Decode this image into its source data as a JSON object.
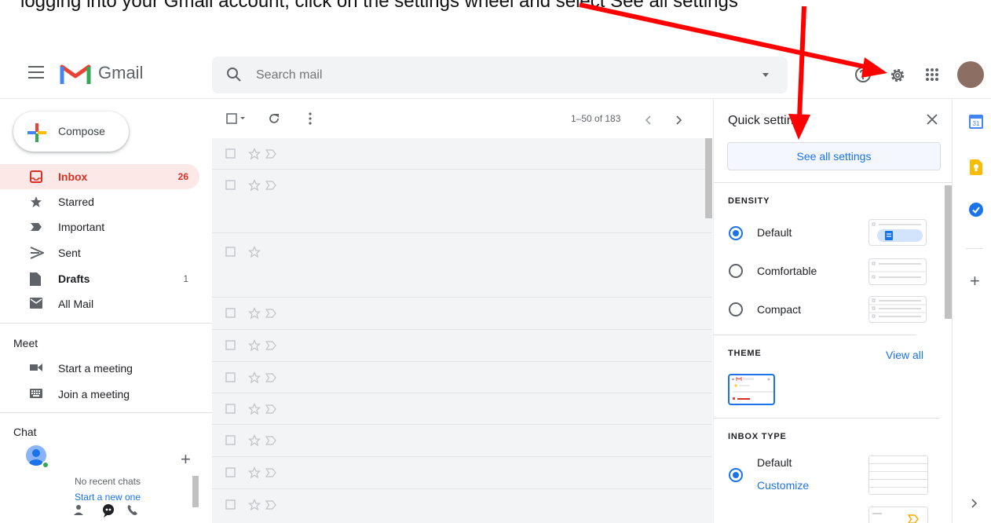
{
  "caption_fragment": "logging into your Gmail account, click on the settings wheel and select See all settings",
  "app": {
    "name": "Gmail"
  },
  "search": {
    "placeholder": "Search mail"
  },
  "header_icons": [
    "help-icon",
    "gear-icon",
    "apps-grid-icon"
  ],
  "compose": {
    "label": "Compose"
  },
  "nav": [
    {
      "label": "Inbox",
      "count": "26",
      "icon": "inbox-icon",
      "selected": true
    },
    {
      "label": "Starred",
      "count": "",
      "icon": "star-icon"
    },
    {
      "label": "Important",
      "count": "",
      "icon": "important-icon"
    },
    {
      "label": "Sent",
      "count": "",
      "icon": "send-icon"
    },
    {
      "label": "Drafts",
      "count": "1",
      "icon": "draft-icon"
    },
    {
      "label": "All Mail",
      "count": "",
      "icon": "mail-icon"
    }
  ],
  "meet": {
    "title": "Meet",
    "items": [
      {
        "label": "Start a meeting",
        "icon": "video-icon"
      },
      {
        "label": "Join a meeting",
        "icon": "keyboard-icon"
      }
    ]
  },
  "chat": {
    "title": "Chat",
    "empty": "No recent chats",
    "start": "Start a new one"
  },
  "toolbar": {
    "pagination": "1–50 of 183"
  },
  "quick_settings": {
    "title": "Quick settings",
    "see_all": "See all settings",
    "density": {
      "title": "DENSITY",
      "options": [
        {
          "label": "Default",
          "selected": true
        },
        {
          "label": "Comfortable",
          "selected": false
        },
        {
          "label": "Compact",
          "selected": false
        }
      ]
    },
    "theme": {
      "title": "THEME",
      "view_all": "View all"
    },
    "inbox_type": {
      "title": "INBOX TYPE",
      "option": "Default",
      "customize": "Customize"
    }
  },
  "colors": {
    "accent": "#1a73e8",
    "inbox_red": "#d93025",
    "arrow": "#ff0000",
    "list_bg": "#f2f4f6"
  }
}
